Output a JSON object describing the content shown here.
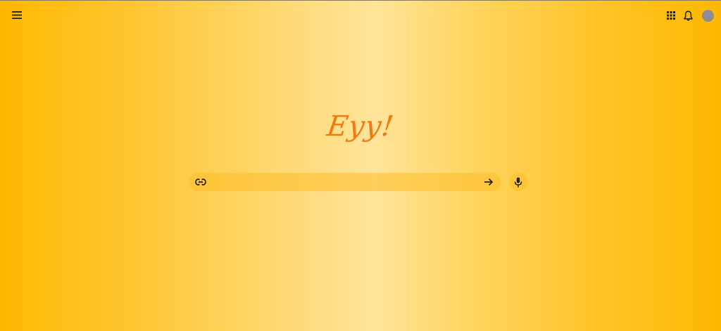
{
  "header": {
    "menu_icon": "hamburger-menu-icon",
    "apps_icon": "apps-grid-icon",
    "notifications_icon": "bell-icon",
    "avatar_color": "#8e8e92"
  },
  "logo": {
    "text": "Eyy!",
    "color": "#f07a10"
  },
  "search": {
    "leading_icon": "link-icon",
    "value": "",
    "placeholder": "",
    "submit_icon": "arrow-right-icon",
    "voice_icon": "microphone-icon"
  },
  "colors": {
    "background_edge": "#ffb800",
    "background_center": "#ffe49a",
    "search_bar_fill": "#ffc530"
  }
}
